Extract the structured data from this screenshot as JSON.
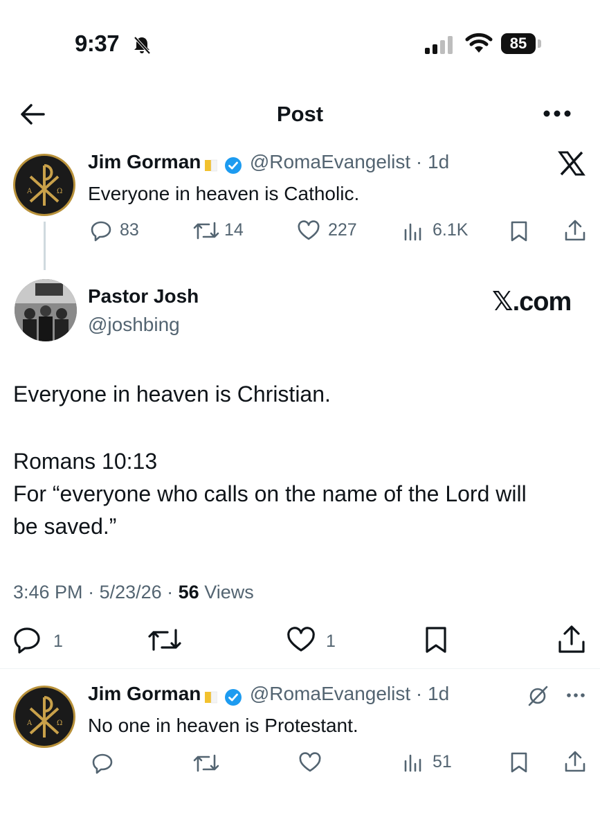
{
  "status_bar": {
    "time": "9:37",
    "battery": "85"
  },
  "nav": {
    "title": "Post"
  },
  "quoted_post": {
    "name": "Jim Gorman",
    "handle": "@RomaEvangelist",
    "age": "1d",
    "text": "Everyone in heaven is Catholic.",
    "replies": "83",
    "reposts": "14",
    "likes": "227",
    "views": "6.1K"
  },
  "main_post": {
    "name": "Pastor Josh",
    "handle": "@joshbing",
    "watermark": "𝕏.com",
    "text_line1": "Everyone in heaven is Christian.",
    "text_line2": "Romans 10:13",
    "text_line3": "For “everyone who calls on the name of the Lord will",
    "text_line4": "be saved.”",
    "time": "3:46 PM",
    "date": "5/23/26",
    "views_count": "56",
    "views_label": "Views",
    "replies": "1",
    "likes": "1"
  },
  "reply_post": {
    "name": "Jim Gorman",
    "handle": "@RomaEvangelist",
    "age": "1d",
    "text": "No one in heaven is Protestant.",
    "views": "51"
  },
  "colors": {
    "accent": "#1d9bf0",
    "muted": "#536471",
    "text": "#0f1419",
    "gold": "#b8913a"
  },
  "icons": [
    "bell-slash-icon",
    "signal-icon",
    "wifi-icon",
    "back-arrow-icon",
    "more-icon",
    "x-logo-icon",
    "reply-icon",
    "repost-icon",
    "like-icon",
    "views-icon",
    "bookmark-icon",
    "share-icon",
    "grok-icon"
  ]
}
